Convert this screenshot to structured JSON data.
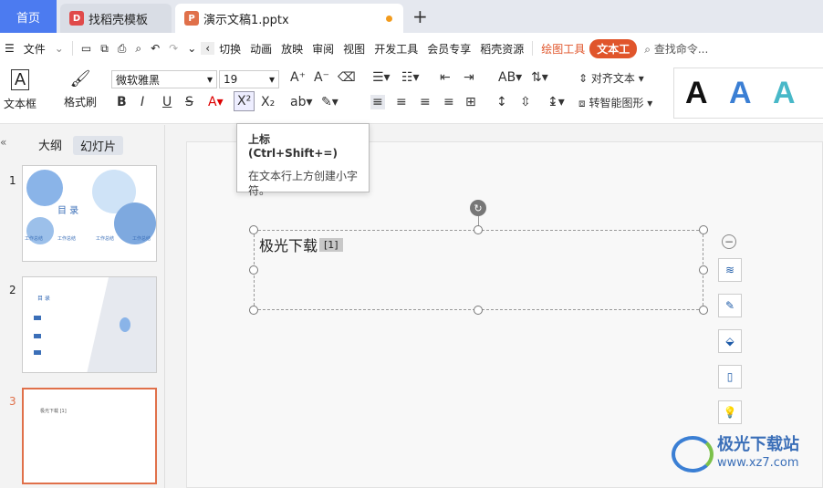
{
  "tabs": {
    "home": "首页",
    "template": "找稻壳模板",
    "doc": "演示文稿1.pptx"
  },
  "menu": {
    "file": "文件",
    "items": [
      "切换",
      "动画",
      "放映",
      "审阅",
      "视图",
      "开发工具",
      "会员专享",
      "稻壳资源"
    ],
    "draw_tools": "绘图工具",
    "text_tools": "文本工",
    "search": "查找命令..."
  },
  "ribbon": {
    "textbox": "文本框",
    "format_painter": "格式刷",
    "font": "微软雅黑",
    "size": "19",
    "align_text": "对齐文本",
    "smart_art": "转智能图形"
  },
  "panel": {
    "outline": "大纲",
    "slides": "幻灯片"
  },
  "thumbs": {
    "n1": "1",
    "n2": "2",
    "n3": "3",
    "t1_title": "目 录",
    "t1_items": [
      "工作总结",
      "工作总结",
      "工作总结",
      "工作总结"
    ],
    "t2_title": "目 录",
    "t3_text": "极光下载 [1]"
  },
  "slide": {
    "text": "极光下载",
    "ref": "[1]"
  },
  "tooltip": {
    "title": "上标 (Ctrl+Shift+=)",
    "desc": "在文本行上方创建小字符。"
  },
  "watermark": {
    "text": "极光下载站",
    "url": "www.xz7.com"
  },
  "colors": {
    "accent": "#4c7bf0",
    "orange": "#e0552b",
    "text_a1": "#111111",
    "text_a2": "#3b7fd4",
    "text_a3": "#48b8c8"
  }
}
